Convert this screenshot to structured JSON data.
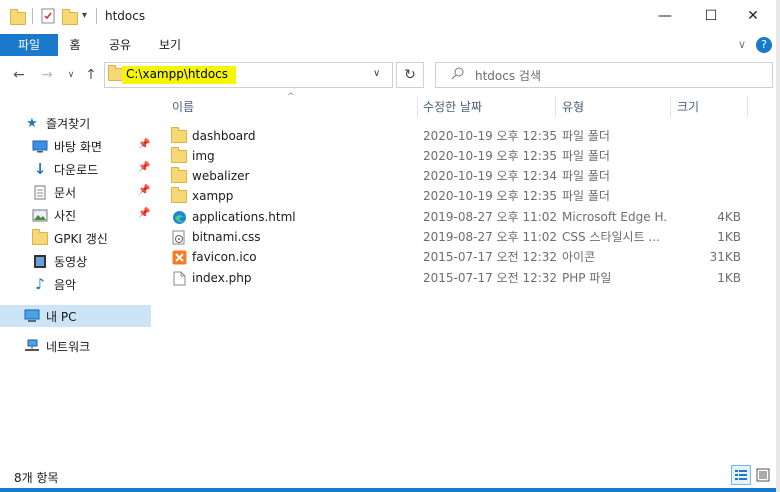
{
  "window": {
    "title": "htdocs",
    "minimize": "—",
    "maximize": "☐",
    "close": "✕"
  },
  "ribbon": {
    "tabs": [
      "파일",
      "홈",
      "공유",
      "보기"
    ],
    "expand": "∨",
    "help": "?"
  },
  "address": {
    "path": "C:\\xampp\\htdocs",
    "dropdown": "∨"
  },
  "search": {
    "placeholder": "htdocs 검색"
  },
  "columns": {
    "name": "이름",
    "modified": "수정한 날짜",
    "type": "유형",
    "size": "크기"
  },
  "nav": {
    "quick_access": "즐겨찾기",
    "items": [
      {
        "label": "바탕 화면",
        "icon": "desktop-icon",
        "pinned": true
      },
      {
        "label": "다운로드",
        "icon": "download-icon",
        "pinned": true
      },
      {
        "label": "문서",
        "icon": "document-icon",
        "pinned": true
      },
      {
        "label": "사진",
        "icon": "pictures-icon",
        "pinned": true
      },
      {
        "label": "GPKI 갱신",
        "icon": "folder-icon",
        "pinned": false
      },
      {
        "label": "동영상",
        "icon": "video-icon",
        "pinned": false
      },
      {
        "label": "음악",
        "icon": "music-icon",
        "pinned": false
      }
    ],
    "this_pc": "내 PC",
    "network": "네트워크"
  },
  "files": [
    {
      "name": "dashboard",
      "modified": "2020-10-19 오후 12:35",
      "type": "파일 폴더",
      "size": "",
      "icon": "folder-icon"
    },
    {
      "name": "img",
      "modified": "2020-10-19 오후 12:35",
      "type": "파일 폴더",
      "size": "",
      "icon": "folder-icon"
    },
    {
      "name": "webalizer",
      "modified": "2020-10-19 오후 12:34",
      "type": "파일 폴더",
      "size": "",
      "icon": "folder-icon"
    },
    {
      "name": "xampp",
      "modified": "2020-10-19 오후 12:35",
      "type": "파일 폴더",
      "size": "",
      "icon": "folder-icon"
    },
    {
      "name": "applications.html",
      "modified": "2019-08-27 오후 11:02",
      "type": "Microsoft Edge H...",
      "size": "4KB",
      "icon": "edge-icon"
    },
    {
      "name": "bitnami.css",
      "modified": "2019-08-27 오후 11:02",
      "type": "CSS 스타일시트 ...",
      "size": "1KB",
      "icon": "css-file-icon"
    },
    {
      "name": "favicon.ico",
      "modified": "2015-07-17 오전 12:32",
      "type": "아이콘",
      "size": "31KB",
      "icon": "xampp-icon"
    },
    {
      "name": "index.php",
      "modified": "2015-07-17 오전 12:32",
      "type": "PHP 파일",
      "size": "1KB",
      "icon": "file-icon"
    }
  ],
  "status": {
    "count": "8개 항목"
  },
  "colors": {
    "accent": "#1979ca",
    "highlight": "#f5f50a",
    "folder": "#f8d775"
  }
}
